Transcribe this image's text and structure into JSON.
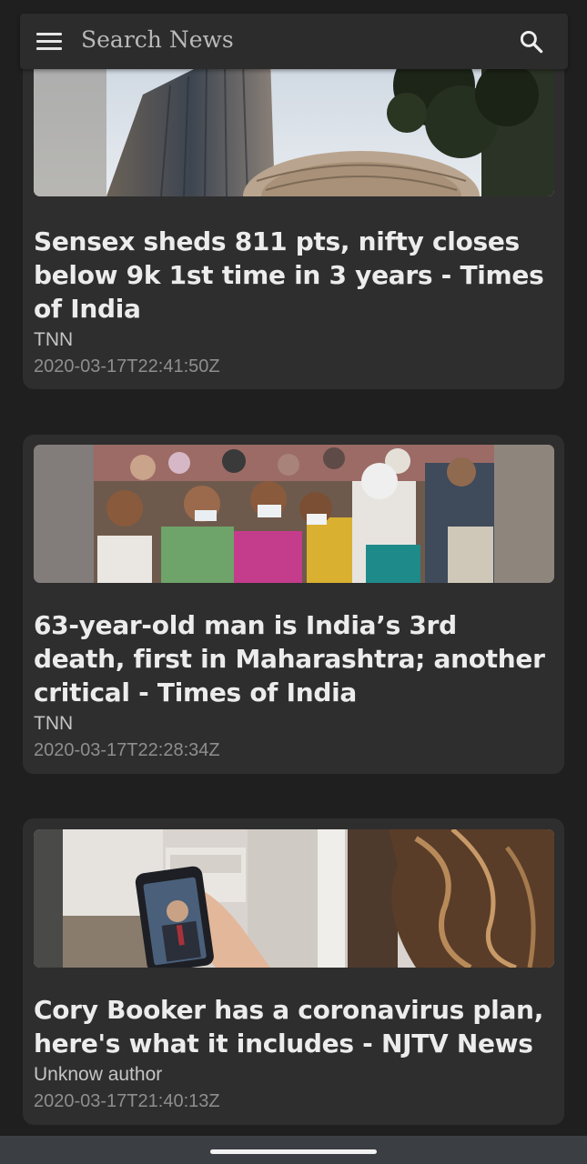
{
  "search": {
    "placeholder": "Search News"
  },
  "icons": {
    "menu": "hamburger-menu-icon",
    "search": "search-icon"
  },
  "articles": [
    {
      "title": "Sensex sheds 811 pts, nifty closes below 9k 1st time in 3 years - Times of India",
      "author": "TNN",
      "published": "2020-03-17T22:41:50Z",
      "image": "stock-exchange-building-photo"
    },
    {
      "title": "63-year-old man is India’s 3rd death, first in Maharashtra; another critical - Times of India",
      "author": "TNN",
      "published": "2020-03-17T22:28:34Z",
      "image": "masked-crowd-photo"
    },
    {
      "title": "Cory Booker has a coronavirus plan, here's what it includes - NJTV News",
      "author": "Unknow author",
      "published": "2020-03-17T21:40:13Z",
      "image": "video-call-phone-photo"
    }
  ],
  "colors": {
    "background": "#1f1f1f",
    "card": "#2e2e2e",
    "search_bar": "#2c2c2c",
    "title_text": "#ececec",
    "author_text": "#c4c4c4",
    "date_text": "#8e8e8e",
    "nav_bar": "#3b3f44"
  }
}
